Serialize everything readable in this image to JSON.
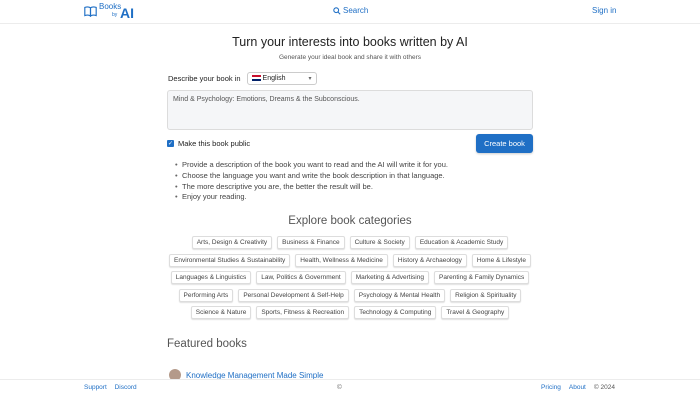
{
  "header": {
    "logo_word1": "Books",
    "logo_word2": "by",
    "logo_word3": "AI",
    "search_label": "Search",
    "signin_label": "Sign in"
  },
  "hero": {
    "title": "Turn your interests into books written by AI",
    "subtitle": "Generate your ideal book and share it with others"
  },
  "form": {
    "language_label": "Describe your book in",
    "language_value": "English",
    "description_value": "Mind & Psychology: Emotions, Dreams & the Subconscious.",
    "public_label": "Make this book public",
    "public_checked": true,
    "create_button": "Create book"
  },
  "tips": [
    "Provide a description of the book you want to read and the AI will write it for you.",
    "Choose the language you want and write the book description in that language.",
    "The more descriptive you are, the better the result will be.",
    "Enjoy your reading."
  ],
  "categories": {
    "title": "Explore book categories",
    "rows": [
      [
        "Arts, Design & Creativity",
        "Business & Finance",
        "Culture & Society",
        "Education & Academic Study"
      ],
      [
        "Environmental Studies & Sustainability",
        "Health, Wellness & Medicine",
        "History & Archaeology",
        "Home & Lifestyle"
      ],
      [
        "Languages & Linguistics",
        "Law, Politics & Government",
        "Marketing & Advertising",
        "Parenting & Family Dynamics"
      ],
      [
        "Performing Arts",
        "Personal Development & Self-Help",
        "Psychology & Mental Health",
        "Religion & Spirituality"
      ],
      [
        "Science & Nature",
        "Sports, Fitness & Recreation",
        "Technology & Computing",
        "Travel & Geography"
      ]
    ]
  },
  "featured": {
    "title": "Featured books",
    "items": [
      {
        "title": "Knowledge Management Made Simple"
      }
    ]
  },
  "footer": {
    "support": "Support",
    "discord": "Discord",
    "middle_icon": "©",
    "pricing": "Pricing",
    "about": "About",
    "copyright": "© 2024"
  },
  "colors": {
    "accent": "#1f6fc5",
    "textarea_bg": "#f5f6f8"
  }
}
